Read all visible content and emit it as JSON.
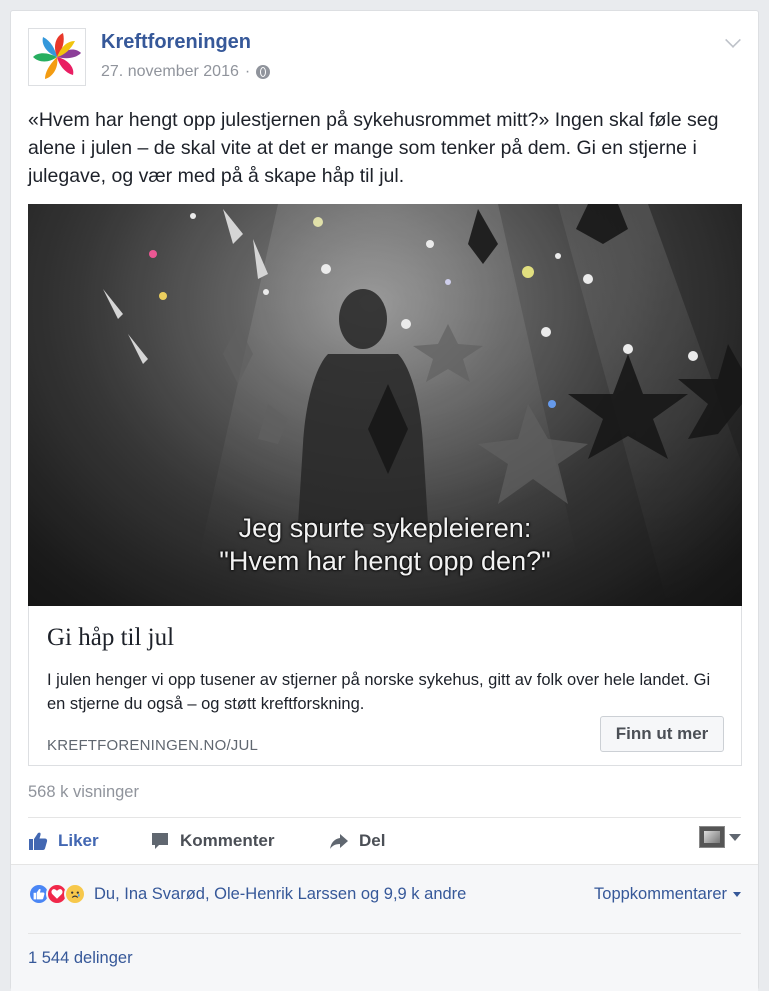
{
  "post": {
    "page_name": "Kreftforeningen",
    "date": "27. november 2016",
    "separator": "·",
    "audience_icon": "globe-icon",
    "text": "«Hvem har hengt opp julestjernen på sykehusrommet mitt?» Ingen skal føle seg alene i julen – de skal vite at det er mange som tenker på dem. Gi en stjerne i julegave, og vær med på å skape håp til jul."
  },
  "video": {
    "subtitle_line1": "Jeg spurte sykepleieren:",
    "subtitle_line2": "\"Hvem har hengt opp den?\""
  },
  "link": {
    "title": "Gi håp til jul",
    "description": "I julen henger vi opp tusener av stjerner på norske sykehus, gitt av folk over hele landet. Gi en stjerne du også – og støtt kreftforskning.",
    "domain": "KREFTFORENINGEN.NO/JUL",
    "cta_label": "Finn ut mer"
  },
  "stats": {
    "views": "568 k visninger",
    "reactors": "Du, Ina Svarød, Ole-Henrik Larssen og 9,9 k andre",
    "top_comments": "Toppkommentarer",
    "shares": "1 544 delinger"
  },
  "actions": {
    "like": "Liker",
    "comment": "Kommenter",
    "share": "Del"
  },
  "colors": {
    "link_blue": "#365899",
    "like_blue": "#4267b2",
    "muted": "#90949c"
  }
}
